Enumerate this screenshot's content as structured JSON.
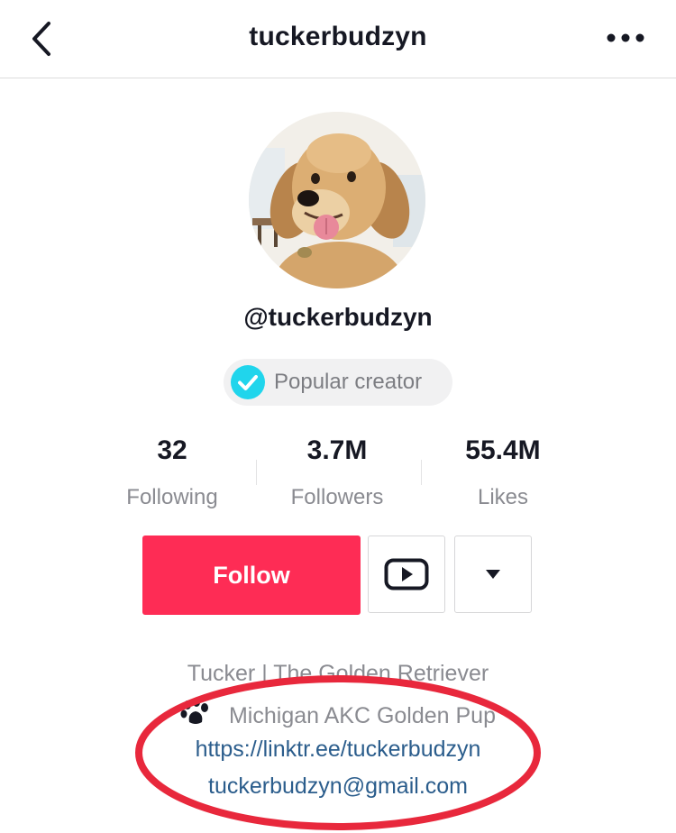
{
  "header": {
    "title": "tuckerbudzyn",
    "back_icon": "chevron-left-icon",
    "more_icon": "more-horizontal-icon"
  },
  "profile": {
    "handle": "@tuckerbudzyn",
    "badge": {
      "label": "Popular creator",
      "icon": "verified-check-icon",
      "icon_color": "#20d5ec"
    }
  },
  "stats": [
    {
      "value": "32",
      "label": "Following"
    },
    {
      "value": "3.7M",
      "label": "Followers"
    },
    {
      "value": "55.4M",
      "label": "Likes"
    }
  ],
  "actions": {
    "follow_label": "Follow",
    "follow_color": "#fe2c55",
    "youtube_icon": "youtube-play-icon",
    "dropdown_icon": "caret-down-icon"
  },
  "bio": {
    "name_line": "Tucker | The Golden Retriever",
    "location_icon": "paw-icon",
    "location_line": "Michigan AKC Golden Pup",
    "link": "https://linktr.ee/tuckerbudzyn",
    "email": "tuckerbudzyn@gmail.com",
    "link_color": "#2b5d8c"
  },
  "annotation": {
    "ring_color": "#e8283c"
  }
}
